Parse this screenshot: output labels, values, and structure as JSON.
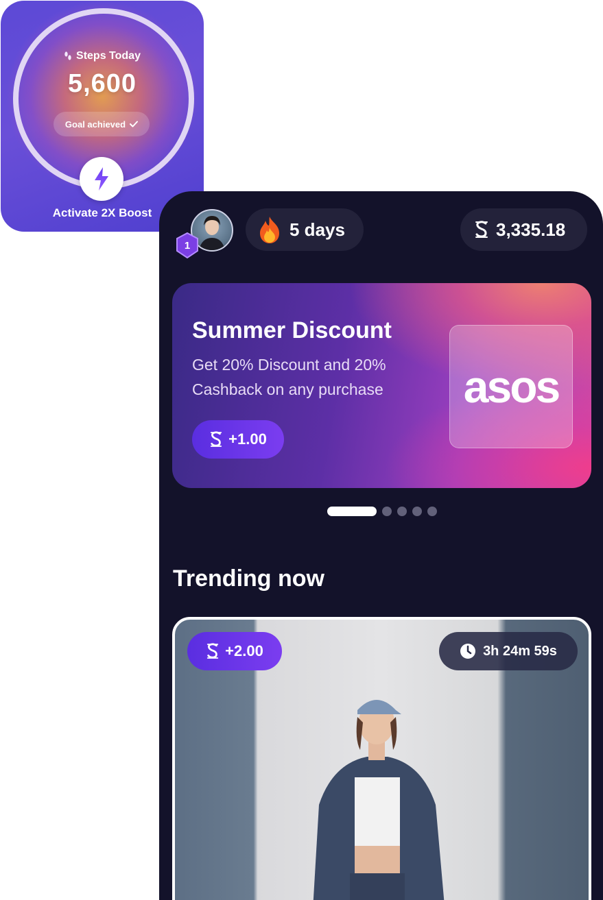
{
  "steps_widget": {
    "label": "Steps Today",
    "value": "5,600",
    "status": "Goal achieved",
    "boost_label": "Activate 2X Boost",
    "icons": {
      "steps": "footprints-icon",
      "status": "check-icon",
      "boost": "lightning-icon"
    }
  },
  "header": {
    "level": "1",
    "streak": "5 days",
    "balance": "3,335.18",
    "icons": {
      "streak": "fire-icon",
      "balance": "coin-icon"
    }
  },
  "banner": {
    "title": "Summer Discount",
    "description": "Get 20% Discount and 20% Cashback on any purchase",
    "reward": "+1.00",
    "brand": "asos"
  },
  "carousel": {
    "count": 5,
    "active_index": 0
  },
  "trending": {
    "title": "Trending now",
    "card": {
      "reward": "+2.00",
      "timer": "3h 24m 59s",
      "icons": {
        "reward": "coin-icon",
        "timer": "clock-icon"
      }
    }
  },
  "colors": {
    "accent_purple": "#6b34ea",
    "background": "#13122a",
    "pill_bg": "#23223a"
  }
}
